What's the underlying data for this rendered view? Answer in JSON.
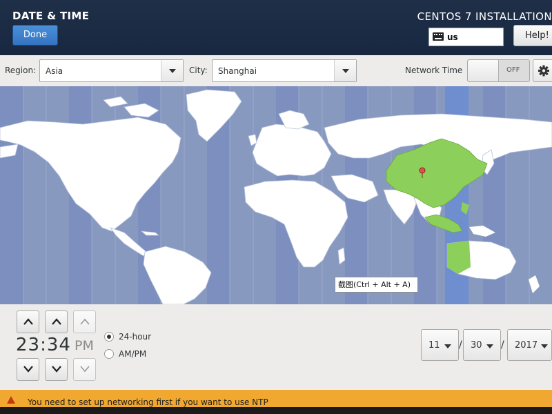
{
  "header": {
    "spoke_title": "DATE & TIME",
    "done_label": "Done",
    "product_title": "CENTOS 7 INSTALLATION",
    "keyboard_layout": "us",
    "help_label": "Help!"
  },
  "location": {
    "region_label": "Region:",
    "region_value": "Asia",
    "city_label": "City:",
    "city_value": "Shanghai",
    "network_time_label": "Network Time",
    "network_time_state": "OFF"
  },
  "map": {
    "tooltip": "截图(Ctrl + Alt + A)",
    "colors": {
      "ocean": "#8899c0",
      "land": "#ffffff",
      "selected_zone": "#8ccf5a",
      "zone_band": "#6f8ed0",
      "pin": "#e05050"
    }
  },
  "time": {
    "hours": "23",
    "separator": ":",
    "minutes": "34",
    "ampm": "PM",
    "format_24_label": "24-hour",
    "format_ampm_label": "AM/PM",
    "selected_format": "24-hour"
  },
  "date": {
    "month": "11",
    "day": "30",
    "year": "2017",
    "separator": "/"
  },
  "warning": {
    "text": "You need to set up networking first if you want to use NTP",
    "color": "#f0a830"
  }
}
